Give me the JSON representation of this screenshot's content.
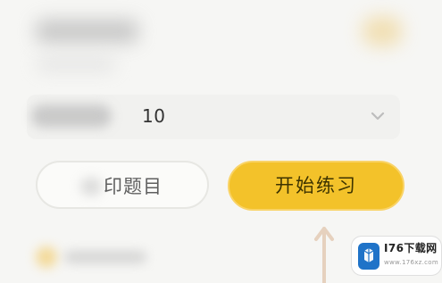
{
  "number_select": {
    "value": "10",
    "icon": "chevron-down-icon"
  },
  "buttons": {
    "print_label": "印题目",
    "start_label": "开始练习"
  },
  "watermark": {
    "title": "I76下载网",
    "subtitle": "www.176xz.com",
    "icon": "watermark-logo-icon"
  },
  "arrow": {
    "icon": "arrow-up-icon",
    "color": "#e7d2c0"
  },
  "colors": {
    "accent": "#f3c22a",
    "accent_border": "#f9d366",
    "button_text": "#3d3300",
    "background": "#f6f6f4",
    "secondary_border": "#e7e7e3"
  }
}
